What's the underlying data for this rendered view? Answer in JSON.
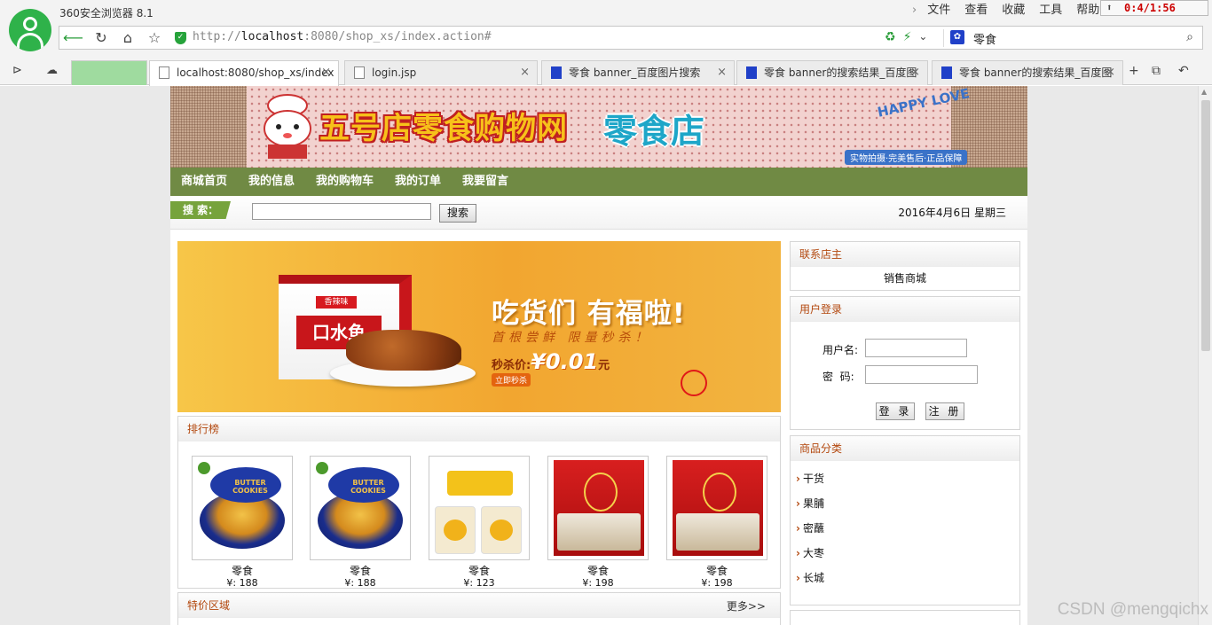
{
  "browser": {
    "title": "360安全浏览器 8.1",
    "menu": [
      "文件",
      "查看",
      "收藏",
      "工具",
      "帮助"
    ],
    "clock": "0:4/1:56",
    "url_prefix": "http://",
    "url_host": "localhost",
    "url_rest": ":8080/shop_xs/index.action#",
    "search_value": "零食",
    "tabs": [
      {
        "label": "",
        "type": "green"
      },
      {
        "label": "localhost:8080/shop_xs/index",
        "type": "active"
      },
      {
        "label": "login.jsp",
        "type": "page"
      },
      {
        "label": "零食 banner_百度图片搜索",
        "type": "baidu"
      },
      {
        "label": "零食 banner的搜索结果_百度图",
        "type": "baidu"
      },
      {
        "label": "零食 banner的搜索结果_百度图",
        "type": "baidu"
      }
    ]
  },
  "site": {
    "banner": {
      "title": "五号店零食购物网",
      "title2": "零食店",
      "happy": "HAPPY LOVE",
      "slogan": "实物拍摄·完美售后·正品保障"
    },
    "nav": [
      "商城首页",
      "我的信息",
      "我的购物车",
      "我的订单",
      "我要留言"
    ],
    "search": {
      "label": "搜 索：",
      "value": "",
      "button": "搜索",
      "date": "2016年4月6日 星期三"
    },
    "promo": {
      "box_brand": "香辣味",
      "box_name": "口水鱼",
      "headline": "吃货们 有福啦!",
      "sub": "首根尝鲜 限量秒杀！",
      "price_label": "秒杀价:",
      "price": "¥0.01",
      "price_unit": "元",
      "cta": "立即秒杀"
    },
    "ranking": {
      "title": "排行榜",
      "items": [
        {
          "name": "零食",
          "price": "¥: 188",
          "art": "cookies"
        },
        {
          "name": "零食",
          "price": "¥: 188",
          "art": "cookies"
        },
        {
          "name": "零食",
          "price": "¥: 123",
          "art": "jars"
        },
        {
          "name": "零食",
          "price": "¥: 198",
          "art": "gift"
        },
        {
          "name": "零食",
          "price": "¥: 198",
          "art": "gift"
        }
      ]
    },
    "special": {
      "title": "特价区域",
      "more": "更多>>"
    },
    "owner": {
      "title": "联系店主",
      "value": "销售商城"
    },
    "login": {
      "title": "用户登录",
      "username_label": "用户名:",
      "password_label": "密  码:",
      "username": "",
      "password": "",
      "login_button": "登 录",
      "register_button": "注 册"
    },
    "categories": {
      "title": "商品分类",
      "items": [
        "干货",
        "果脯",
        "密蘸",
        "大枣",
        "长城"
      ]
    },
    "watermark": "CSDN @mengqichx"
  }
}
